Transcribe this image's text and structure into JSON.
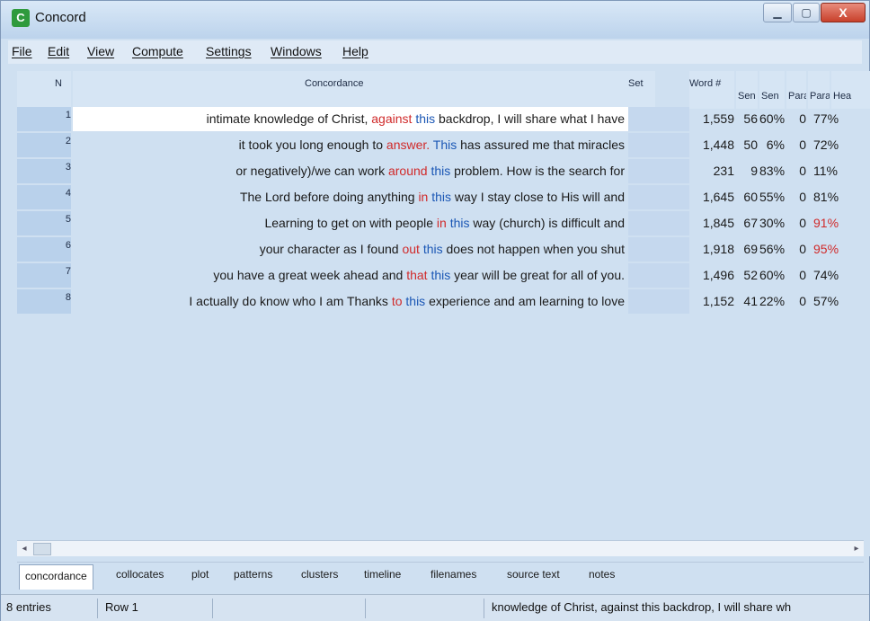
{
  "window": {
    "title": "Concord",
    "app_icon": "C",
    "close_glyph": "X"
  },
  "menu": [
    "File",
    "Edit",
    "View",
    "Compute",
    "Settings",
    "Windows",
    "Help"
  ],
  "table": {
    "headers": {
      "n": "N",
      "concordance": "Concordance",
      "set": "Set",
      "word": "Word #",
      "sen1": "Sen",
      "sen2": "Sen",
      "par1": "Para",
      "par2": "Para",
      "head": "Hea"
    },
    "rows": [
      {
        "n": "1",
        "pre": "intimate knowledge of Christ,",
        "kw1": "against",
        "kw2": "this",
        "post": "backdrop, I will share what I have",
        "word": "1,559",
        "sen": "56",
        "senpct": "60%",
        "par": "0",
        "parpct": "77%",
        "parred": false
      },
      {
        "n": "2",
        "pre": "it took you long enough to",
        "kw1": "answer.",
        "kw2": "This",
        "post": "has assured me that miracles",
        "word": "1,448",
        "sen": "50",
        "senpct": "6%",
        "par": "0",
        "parpct": "72%",
        "parred": false
      },
      {
        "n": "3",
        "pre": "or negatively)/we can work",
        "kw1": "around",
        "kw2": "this",
        "post": "problem. How is the search for",
        "word": "231",
        "sen": "9",
        "senpct": "83%",
        "par": "0",
        "parpct": "11%",
        "parred": false
      },
      {
        "n": "4",
        "pre": "The Lord before doing anything",
        "kw1": "in",
        "kw2": "this",
        "post": "way I stay close to His will and",
        "word": "1,645",
        "sen": "60",
        "senpct": "55%",
        "par": "0",
        "parpct": "81%",
        "parred": false
      },
      {
        "n": "5",
        "pre": "Learning to get on with people",
        "kw1": "in",
        "kw2": "this",
        "post": "way (church) is difficult and",
        "word": "1,845",
        "sen": "67",
        "senpct": "30%",
        "par": "0",
        "parpct": "91%",
        "parred": true
      },
      {
        "n": "6",
        "pre": "your character as I found",
        "kw1": "out",
        "kw2": "this",
        "post": "does not happen when you shut",
        "word": "1,918",
        "sen": "69",
        "senpct": "56%",
        "par": "0",
        "parpct": "95%",
        "parred": true
      },
      {
        "n": "7",
        "pre": "you have a great week ahead and",
        "kw1": "that",
        "kw2": "this",
        "post": "year will be great for all of you.",
        "word": "1,496",
        "sen": "52",
        "senpct": "60%",
        "par": "0",
        "parpct": "74%",
        "parred": false
      },
      {
        "n": "8",
        "pre": "I actually do know who I am Thanks",
        "kw1": "to",
        "kw2": "this",
        "post": "experience and am learning to love",
        "word": "1,152",
        "sen": "41",
        "senpct": "22%",
        "par": "0",
        "parpct": "57%",
        "parred": false
      }
    ]
  },
  "scroll": {
    "left_glyph": "◂",
    "right_glyph": "▸"
  },
  "tabs": [
    "concordance",
    "collocates",
    "plot",
    "patterns",
    "clusters",
    "timeline",
    "filenames",
    "source text",
    "notes"
  ],
  "status": {
    "entries": "8 entries",
    "row": "Row 1",
    "preview": "knowledge of Christ, against this backdrop, I will share wh"
  },
  "colors": {
    "node_word": "#1b57b5",
    "context_word": "#d02a2a"
  }
}
